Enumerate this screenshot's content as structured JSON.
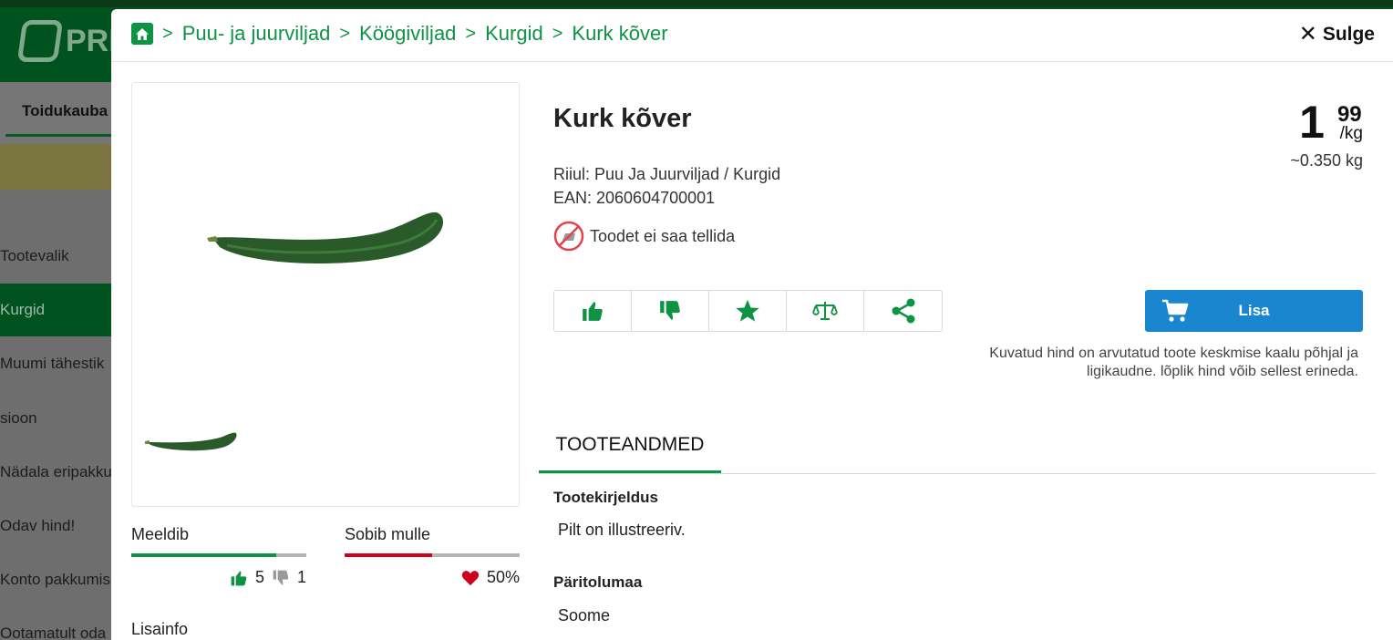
{
  "background": {
    "logo_text": "PRI",
    "nav_label": "Toidukauba",
    "sidebar_items": [
      {
        "label": "Tootevalik",
        "active": false
      },
      {
        "label": "Kurgid",
        "active": true
      },
      {
        "label": "Muumi tähestik",
        "active": false
      },
      {
        "label": "sioon",
        "active": false
      },
      {
        "label": "Nädala eripakku",
        "active": false
      },
      {
        "label": "Odav hind!",
        "active": false
      },
      {
        "label": "Konto pakkumis",
        "active": false
      },
      {
        "label": "Ootamatult oda",
        "active": false
      }
    ]
  },
  "breadcrumb": {
    "items": [
      "Puu- ja juurviljad",
      "Köögiviljad",
      "Kurgid",
      "Kurk kõver"
    ]
  },
  "close_label": "Sulge",
  "product": {
    "title": "Kurk kõver",
    "shelf": "Riiul: Puu Ja Juurviljad / Kurgid",
    "ean": "EAN: 2060604700001",
    "not_orderable": "Toodet ei saa tellida",
    "price_int": "1",
    "price_dec": "99",
    "price_unit": "/kg",
    "price_weight": "~0.350 kg",
    "add_label": "Lisa",
    "price_note": "Kuvatud hind on arvutatud toote keskmise kaalu põhjal ja ligikaudne. lõplik hind võib sellest erineda."
  },
  "actions": [
    "thumbs-up-icon",
    "thumbs-down-icon",
    "star-icon",
    "scale-icon",
    "share-icon"
  ],
  "ratings": {
    "likes_title": "Meeldib",
    "likes_count": "5",
    "dislikes_count": "1",
    "likes_fraction": 0.83,
    "suits_title": "Sobib mulle",
    "suits_percent": "50%",
    "suits_fraction": 0.5
  },
  "lisainfo": "Lisainfo",
  "tab_label": "TOOTEANDMED",
  "fields": [
    {
      "label": "Tootekirjeldus",
      "value": "Pilt on illustreeriv."
    },
    {
      "label": "Päritolumaa",
      "value": "Soome"
    }
  ],
  "colors": {
    "brand_green": "#0e9244",
    "button_blue": "#1a86d0",
    "dislike_red": "#d0021b"
  }
}
